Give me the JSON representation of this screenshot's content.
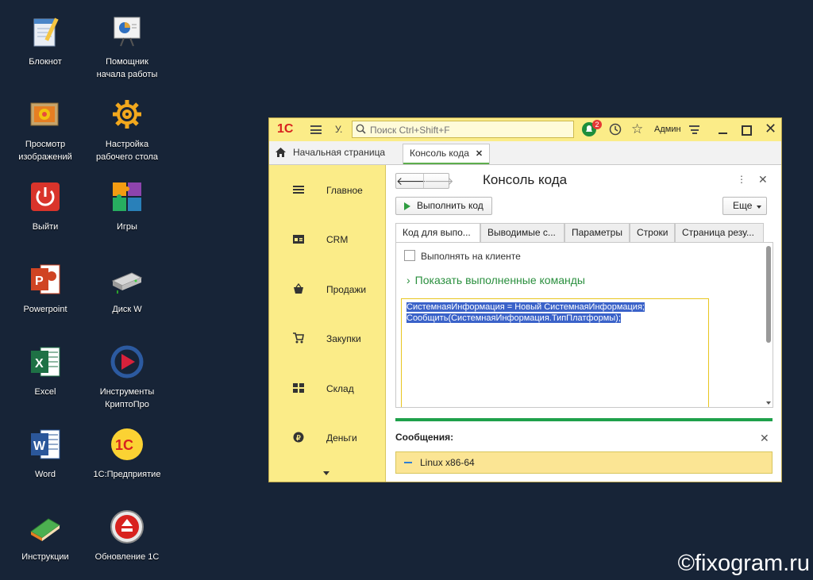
{
  "desktop": {
    "icons": [
      {
        "label_line1": "Блокнот",
        "label_line2": ""
      },
      {
        "label_line1": "Помощник",
        "label_line2": "начала работы"
      },
      {
        "label_line1": "Просмотр",
        "label_line2": "изображений"
      },
      {
        "label_line1": "Настройка",
        "label_line2": "рабочего стола"
      },
      {
        "label_line1": "Выйти",
        "label_line2": ""
      },
      {
        "label_line1": "Игры",
        "label_line2": ""
      },
      {
        "label_line1": "Powerpoint",
        "label_line2": ""
      },
      {
        "label_line1": "Диск W",
        "label_line2": ""
      },
      {
        "label_line1": "Excel",
        "label_line2": ""
      },
      {
        "label_line1": "Инструменты",
        "label_line2": "КриптоПро"
      },
      {
        "label_line1": "Word",
        "label_line2": ""
      },
      {
        "label_line1": "1С:Предприятие",
        "label_line2": ""
      },
      {
        "label_line1": "Инструкции",
        "label_line2": ""
      },
      {
        "label_line1": "Обновление 1С",
        "label_line2": ""
      }
    ]
  },
  "window": {
    "logo": "1С",
    "titlebar": {
      "short_label": "У.",
      "search_placeholder": "Поиск Ctrl+Shift+F",
      "notifications_count": "2",
      "user": "Админ"
    },
    "tabs": {
      "home": "Начальная страница",
      "active": "Консоль кода"
    },
    "sidebar": [
      {
        "label": "Главное",
        "icon": "list-icon"
      },
      {
        "label": "CRM",
        "icon": "crm-icon"
      },
      {
        "label": "Продажи",
        "icon": "basket-icon"
      },
      {
        "label": "Закупки",
        "icon": "cart-icon"
      },
      {
        "label": "Склад",
        "icon": "warehouse-icon"
      },
      {
        "label": "Деньги",
        "icon": "money-icon"
      }
    ],
    "content": {
      "title": "Консоль кода",
      "run_button": "Выполнить код",
      "more_button": "Еще",
      "form_tabs": [
        "Код для выпо...",
        "Выводимые с...",
        "Параметры",
        "Строки",
        "Страница резу..."
      ],
      "checkbox_label": "Выполнять на клиенте",
      "show_commands": "Показать выполненные команды",
      "code_line1": "СистемнаяИнформация = Новый СистемнаяИнформация;",
      "code_line2": "Сообщить(СистемнаяИнформация.ТипПлатформы);",
      "messages_title": "Сообщения:",
      "message_text": "Linux x86-64"
    }
  },
  "watermark": "©fixogram.ru",
  "colors": {
    "desktop_bg": "#172437",
    "window_yellow": "#fbec88",
    "accent_green": "#1fa14b",
    "selection_blue": "#3a62c9"
  }
}
